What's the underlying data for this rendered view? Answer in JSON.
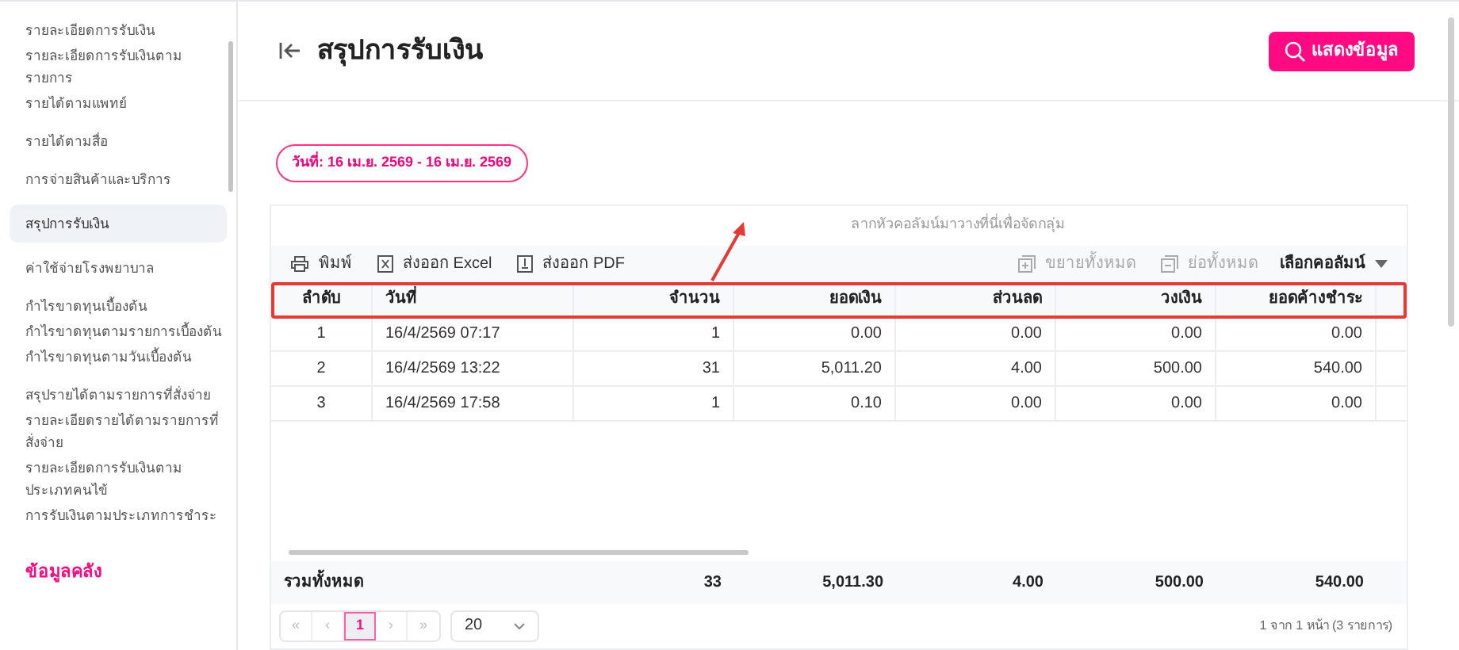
{
  "sidebar": {
    "groups": [
      {
        "items": [
          {
            "label": "รายละเอียดการรับเงิน",
            "selected": false
          },
          {
            "label": "รายละเอียดการรับเงินตามรายการ",
            "selected": false
          },
          {
            "label": "รายได้ตามแพทย์",
            "selected": false
          }
        ]
      },
      {
        "items": [
          {
            "label": "รายได้ตามสื่อ",
            "selected": false
          }
        ]
      },
      {
        "items": [
          {
            "label": "การจ่ายสินค้าและบริการ",
            "selected": false
          }
        ]
      },
      {
        "items": [
          {
            "label": "สรุปการรับเงิน",
            "selected": true
          }
        ]
      },
      {
        "items": [
          {
            "label": "ค่าใช้จ่ายโรงพยาบาล",
            "selected": false
          }
        ]
      },
      {
        "items": [
          {
            "label": "กำไรขาดทุนเบื้องต้น",
            "selected": false
          },
          {
            "label": "กำไรขาดทุนตามรายการเบื้องต้น",
            "selected": false
          },
          {
            "label": "กำไรขาดทุนตามวันเบื้องต้น",
            "selected": false
          }
        ]
      },
      {
        "items": [
          {
            "label": "สรุปรายได้ตามรายการที่สั่งจ่าย",
            "selected": false
          },
          {
            "label": "รายละเอียดรายได้ตามรายการที่สั่งจ่าย",
            "selected": false
          },
          {
            "label": "รายละเอียดการรับเงินตามประเภทคนไข้",
            "selected": false
          },
          {
            "label": "การรับเงินตามประเภทการชำระ",
            "selected": false
          }
        ]
      }
    ],
    "section": "ข้อมูลคลัง"
  },
  "header": {
    "title": "สรุปการรับเงิน",
    "button": "แสดงข้อมูล"
  },
  "date_filter": "วันที่: 16 เม.ย. 2569 - 16 เม.ย. 2569",
  "grid": {
    "group_hint": "ลากหัวคอลัมน์มาวางที่นี่เพื่อจัดกลุ่ม",
    "toolbar": [
      {
        "label": "พิมพ์",
        "kind": "print",
        "disabled": false
      },
      {
        "label": "ส่งออก Excel",
        "kind": "excel",
        "disabled": false
      },
      {
        "label": "ส่งออก PDF",
        "kind": "pdf",
        "disabled": false
      }
    ],
    "toolbar_right": [
      {
        "label": "ขยายทั้งหมด",
        "kind": "expand",
        "disabled": true
      },
      {
        "label": "ย่อทั้งหมด",
        "kind": "collapse",
        "disabled": true
      }
    ],
    "column_chooser": "เลือกคอลัมน์",
    "columns": [
      "ลำดับ",
      "วันที่",
      "จำนวน",
      "ยอดเงิน",
      "ส่วนลด",
      "วงเงิน",
      "ยอดค้างชำระ"
    ],
    "rows": [
      [
        "1",
        "16/4/2569 07:17",
        "1",
        "0.00",
        "0.00",
        "0.00",
        "0.00"
      ],
      [
        "2",
        "16/4/2569 13:22",
        "31",
        "5,011.20",
        "4.00",
        "500.00",
        "540.00"
      ],
      [
        "3",
        "16/4/2569 17:58",
        "1",
        "0.10",
        "0.00",
        "0.00",
        "0.00"
      ]
    ],
    "totals": {
      "label": "รวมทั้งหมด",
      "values": [
        "33",
        "5,011.30",
        "4.00",
        "500.00",
        "540.00"
      ]
    },
    "pager": {
      "first": "«",
      "prev": "‹",
      "pages": [
        {
          "label": "1",
          "selected": true
        }
      ],
      "next": "›",
      "last": "»",
      "page_size": "20",
      "summary": "1 จาก 1 หน้า (3 รายการ)"
    }
  }
}
